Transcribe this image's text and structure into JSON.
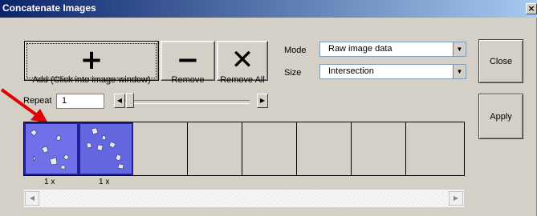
{
  "window": {
    "title": "Concatenate Images",
    "close_glyph": "×"
  },
  "toolbar": {
    "add_glyph": "+",
    "add_label": "Add (Click into image window)",
    "remove_glyph": "−",
    "remove_label": "Remove",
    "removeall_glyph": "✕",
    "removeall_label": "Remove All"
  },
  "options": {
    "mode_label": "Mode",
    "mode_value": "Raw image data",
    "size_label": "Size",
    "size_value": "Intersection"
  },
  "repeat": {
    "label": "Repeat",
    "value": "1",
    "slider_level": 0.0
  },
  "side_buttons": {
    "close_label": "Close",
    "apply_label": "Apply"
  },
  "strip": {
    "captions": [
      "1 x",
      "1 x"
    ],
    "thumbnail_count": 2,
    "empty_slot_count": 6
  },
  "colors": {
    "title_gradient_start": "#0a246a",
    "title_gradient_end": "#a6caf0",
    "window_bg": "#d4d0c8",
    "thumbnail_bg": "#6a6ee0",
    "pointer_arrow": "#e00000"
  },
  "icons": {
    "scroll_left": "arrow-left-icon",
    "scroll_right": "arrow-right-icon",
    "dropdown": "chevron-down-icon"
  }
}
